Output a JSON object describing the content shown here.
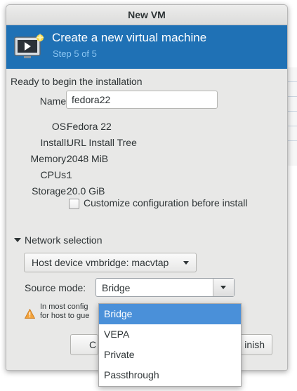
{
  "window": {
    "title": "New VM"
  },
  "header": {
    "title": "Create a new virtual machine",
    "step": "Step 5 of 5",
    "icon": "vm-screen-icon"
  },
  "summary": {
    "heading": "Ready to begin the installation",
    "name_label": "Name:",
    "name_value": "fedora22",
    "rows": [
      {
        "label": "OS:",
        "value": "Fedora 22"
      },
      {
        "label": "Install:",
        "value": "URL Install Tree"
      },
      {
        "label": "Memory:",
        "value": "2048 MiB"
      },
      {
        "label": "CPUs:",
        "value": "1"
      },
      {
        "label": "Storage:",
        "value": "20.0 GiB"
      }
    ],
    "customize_label": "Customize configuration before install",
    "customize_checked": false
  },
  "network": {
    "expander_label": "Network selection",
    "host_device": "Host device vmbridge: macvtap",
    "source_mode_label": "Source mode:",
    "source_mode_value": "Bridge",
    "warning_text_line1": "In most config",
    "warning_text_line2": "for host to gue",
    "options": [
      "Bridge",
      "VEPA",
      "Private",
      "Passthrough"
    ],
    "selected_option": "Bridge"
  },
  "buttons": {
    "cancel_partial": "C",
    "finish_partial": "inish"
  },
  "colors": {
    "header_bg": "#1f71b5",
    "step_text": "#8cc6f2",
    "selection": "#4a90d9"
  }
}
